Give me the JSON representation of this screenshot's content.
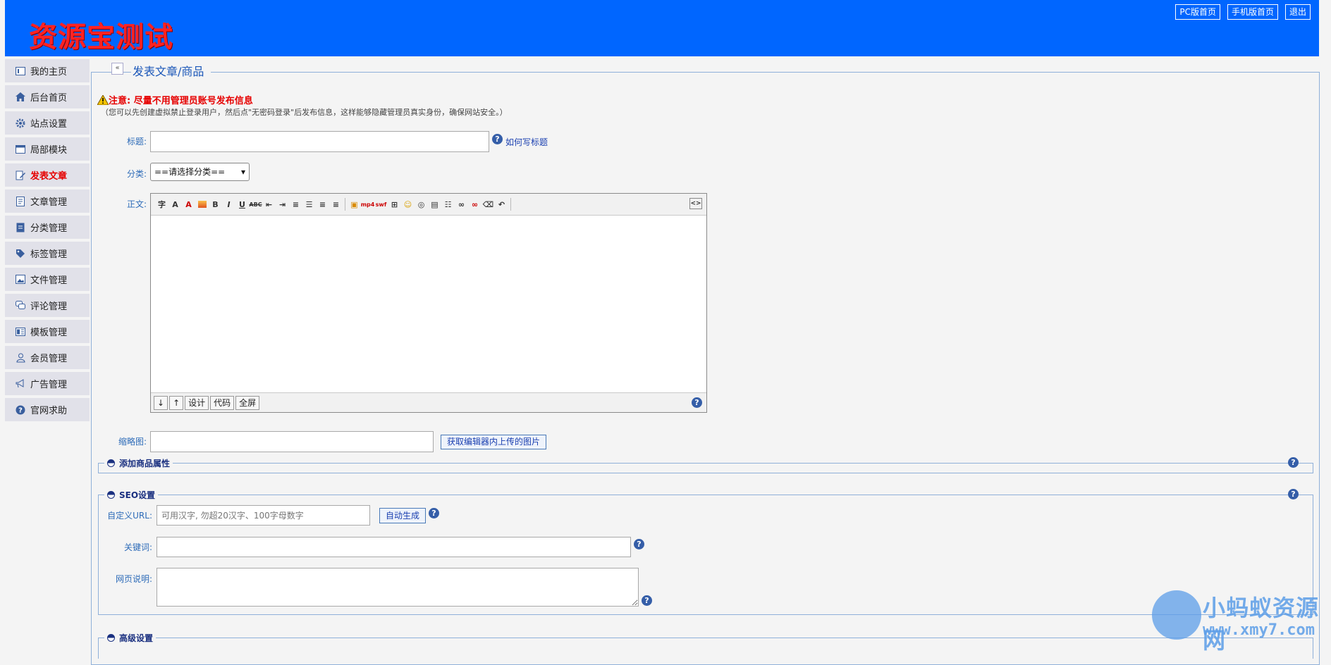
{
  "header": {
    "logo_text": "资源宝测试",
    "links": [
      "PC版首页",
      "手机版首页",
      "退出"
    ]
  },
  "sidebar": {
    "items": [
      {
        "label": "我的主页",
        "icon": "homepage-card-icon"
      },
      {
        "label": "后台首页",
        "icon": "house-icon"
      },
      {
        "label": "站点设置",
        "icon": "gear-icon"
      },
      {
        "label": "局部模块",
        "icon": "module-window-icon"
      },
      {
        "label": "发表文章",
        "icon": "edit-doc-icon"
      },
      {
        "label": "文章管理",
        "icon": "document-icon"
      },
      {
        "label": "分类管理",
        "icon": "category-doc-icon"
      },
      {
        "label": "标签管理",
        "icon": "tag-icon"
      },
      {
        "label": "文件管理",
        "icon": "image-file-icon"
      },
      {
        "label": "评论管理",
        "icon": "comment-icon"
      },
      {
        "label": "模板管理",
        "icon": "template-icon"
      },
      {
        "label": "会员管理",
        "icon": "user-icon"
      },
      {
        "label": "广告管理",
        "icon": "megaphone-icon"
      },
      {
        "label": "官网求助",
        "icon": "help-icon"
      }
    ],
    "active_index": 4
  },
  "page": {
    "title": "发表文章/商品",
    "collapse_symbol": "«",
    "warning": "注意: 尽量不用管理员账号发布信息",
    "warning_sub": "（您可以先创建虚拟禁止登录用户，然后点\"无密码登录\"后发布信息，这样能够隐藏管理员真实身份，确保网站安全。）"
  },
  "form": {
    "title_label": "标题:",
    "title_value": "",
    "how_to_title": "如何写标题",
    "category_label": "分类:",
    "category_value": "==请选择分类==",
    "body_label": "正文:",
    "editor_bottom_buttons": [
      "↓",
      "↑",
      "设计",
      "代码",
      "全屏"
    ],
    "thumb_label": "缩略图:",
    "thumb_value": "",
    "get_image_button": "获取编辑器内上传的图片"
  },
  "sections": {
    "product_attr": "添加商品属性",
    "seo": "SEO设置",
    "advanced": "高级设置"
  },
  "seo": {
    "url_label": "自定义URL:",
    "url_placeholder": "可用汉字, 勿超20汉字、100字母数字",
    "auto_button": "自动生成",
    "keywords_label": "关键词:",
    "keywords_value": "",
    "desc_label": "网页说明:",
    "desc_value": ""
  },
  "watermark": {
    "title": "小蚂蚁资源网",
    "url": "www.xmy7.com"
  },
  "colors": {
    "header_bg": "#0066ff",
    "logo": "#ff2222",
    "active_nav": "#e60000",
    "label": "#2d6bb8"
  }
}
